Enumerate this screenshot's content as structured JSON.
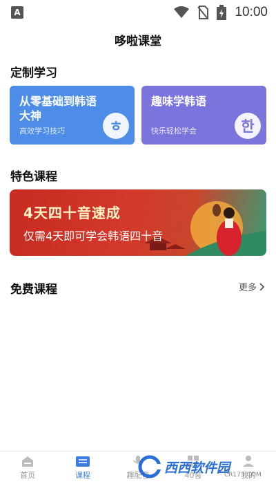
{
  "status_bar": {
    "time": "10:00",
    "left_icon_letter": "A"
  },
  "header": {
    "title": "哆啦课堂"
  },
  "custom_study": {
    "title": "定制学习",
    "cards": [
      {
        "title": "从零基础到韩语大神",
        "subtitle": "高效学习技巧",
        "badge": "ㅎ",
        "color": "#4d8de8"
      },
      {
        "title": "趣味学韩语",
        "subtitle": "快乐轻松学会",
        "badge": "한",
        "color": "#7b74dc"
      }
    ]
  },
  "featured": {
    "title": "特色课程",
    "banner": {
      "headline": "4天四十音速成",
      "description": "仅需4天即可学会韩语四十音"
    }
  },
  "free_courses": {
    "title": "免费课程",
    "more_label": "更多"
  },
  "tab_bar": {
    "tabs": [
      {
        "label": "首页",
        "icon": "home-icon",
        "active": false
      },
      {
        "label": "课程",
        "icon": "book-icon",
        "active": true
      },
      {
        "label": "趣配音",
        "icon": "microphone-icon",
        "active": false
      },
      {
        "label": "40音",
        "icon": "grid-icon",
        "active": false
      },
      {
        "label": "我的",
        "icon": "person-icon",
        "active": false
      }
    ]
  },
  "watermark": {
    "main": "西西软件园",
    "sub": "CR173.COM"
  },
  "colors": {
    "accent": "#3b7de0",
    "banner_red": "#c72b21",
    "banner_green": "#3b9a72"
  }
}
